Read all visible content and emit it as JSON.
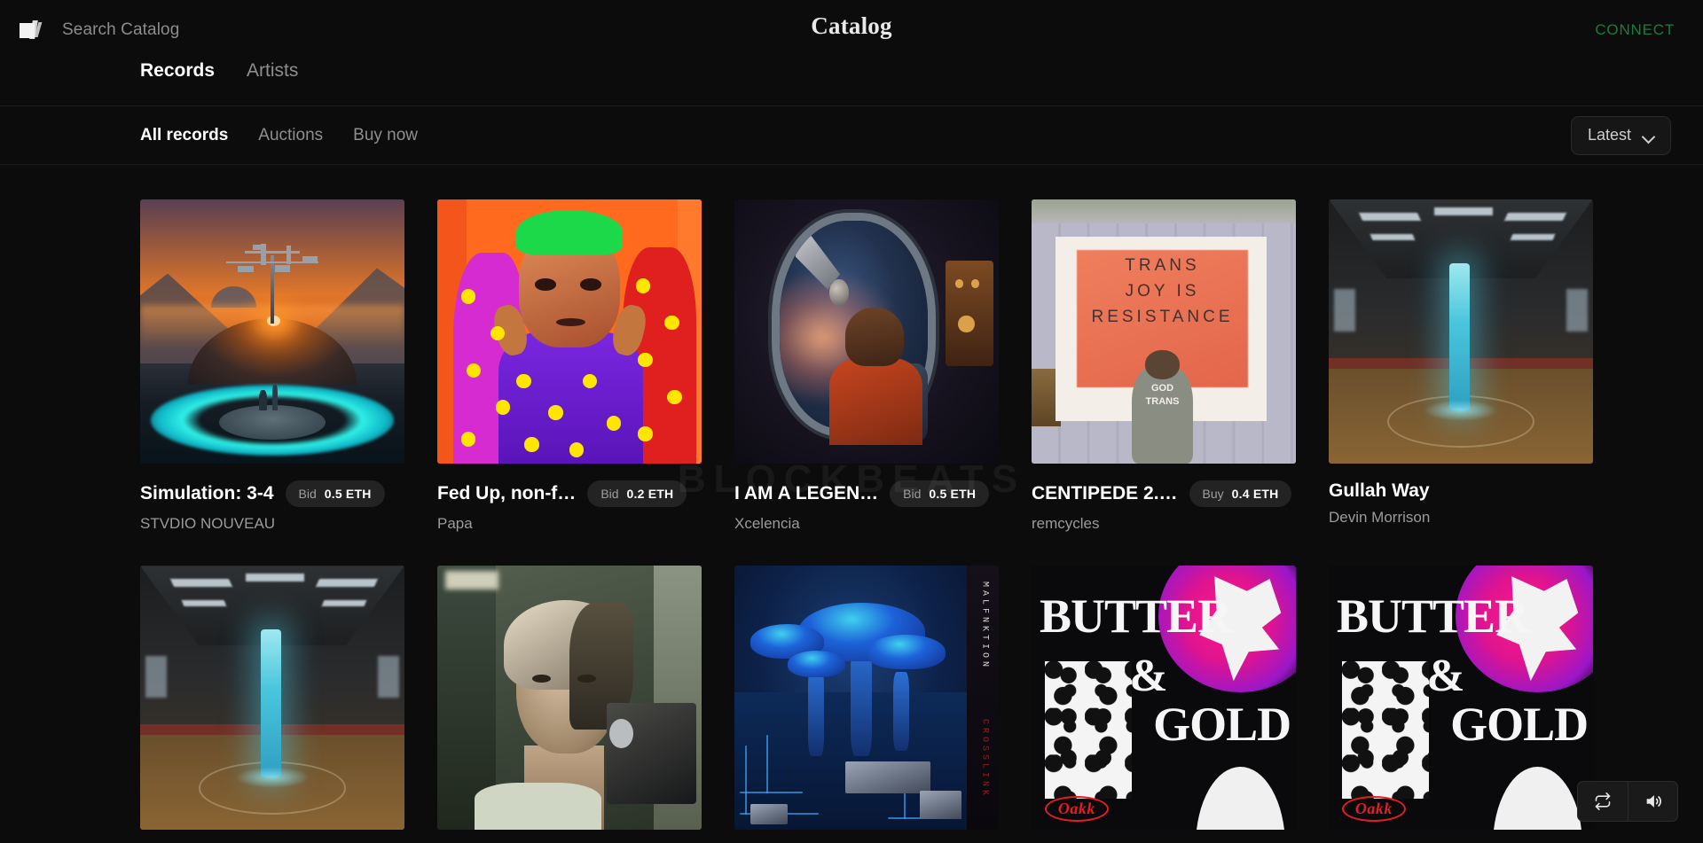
{
  "header": {
    "logo_icon": "stacked-records-icon",
    "search_placeholder": "Search Catalog",
    "search_value": "",
    "brand": "Catalog",
    "connect_label": "CONNECT",
    "connect_color": "#1e7a3c"
  },
  "nav": {
    "items": [
      {
        "label": "Records",
        "active": true
      },
      {
        "label": "Artists",
        "active": false
      }
    ]
  },
  "filters": {
    "items": [
      {
        "label": "All records",
        "active": true
      },
      {
        "label": "Auctions",
        "active": false
      },
      {
        "label": "Buy now",
        "active": false
      }
    ],
    "sort": {
      "value": "Latest",
      "icon": "chevron-down-icon"
    }
  },
  "watermark": "BLOCKBEATS",
  "records": [
    {
      "title": "Simulation: 3-4",
      "artist": "STVDIO NOUVEAU",
      "badge": {
        "kind": "Bid",
        "price": "0.5 ETH"
      },
      "art_alt": "sci-fi sunset landscape with dome and glowing cyan ring"
    },
    {
      "title": "Fed Up, non-f…",
      "artist": "Papa",
      "badge": {
        "kind": "Bid",
        "price": "0.2 ETH"
      },
      "art_alt": "pop-art portrait with green hair and yellow polka dots"
    },
    {
      "title": "I AM A LEGEN…",
      "artist": "Xcelencia",
      "badge": {
        "kind": "Bid",
        "price": "0.5 ETH"
      },
      "art_alt": "child looking out a spaceship window at a planet"
    },
    {
      "title": "CENTIPEDE 2.…",
      "artist": "remcycles",
      "badge": {
        "kind": "Buy",
        "price": "0.4 ETH"
      },
      "art_alt": "faded photo of person painting TRANS JOY IS RESISTANCE banner",
      "art_text": {
        "line1": "TRANS",
        "line2": "JOY IS",
        "line3": "RESISTANCE",
        "shirt1": "GOD",
        "shirt2": "TRANS"
      }
    },
    {
      "title": "Gullah Way",
      "artist": "Devin Morrison",
      "badge": null,
      "art_alt": "warehouse interior with glowing cyan column"
    },
    {
      "title": "",
      "artist": "",
      "badge": null,
      "art_alt": "warehouse interior with glowing cyan column"
    },
    {
      "title": "",
      "artist": "",
      "badge": null,
      "art_alt": "vintage film portrait of a woman holding a camera"
    },
    {
      "title": "",
      "artist": "",
      "badge": null,
      "art_alt": "blue circuit-board mushrooms",
      "art_text": {
        "top": "MALFNKTION",
        "bottom": "CROSSLINK"
      }
    },
    {
      "title": "",
      "artist": "",
      "badge": null,
      "art_alt": "BUTTER & GOLD poster artwork",
      "art_text": {
        "w1": "BUTTER",
        "w2": "&",
        "w3": "GOLD",
        "logo": "Oakk"
      }
    },
    {
      "title": "",
      "artist": "",
      "badge": null,
      "art_alt": "BUTTER & GOLD poster artwork",
      "art_text": {
        "w1": "BUTTER",
        "w2": "&",
        "w3": "GOLD",
        "logo": "Oakk"
      }
    }
  ],
  "player": {
    "repeat_icon": "repeat-icon",
    "volume_icon": "volume-icon"
  }
}
